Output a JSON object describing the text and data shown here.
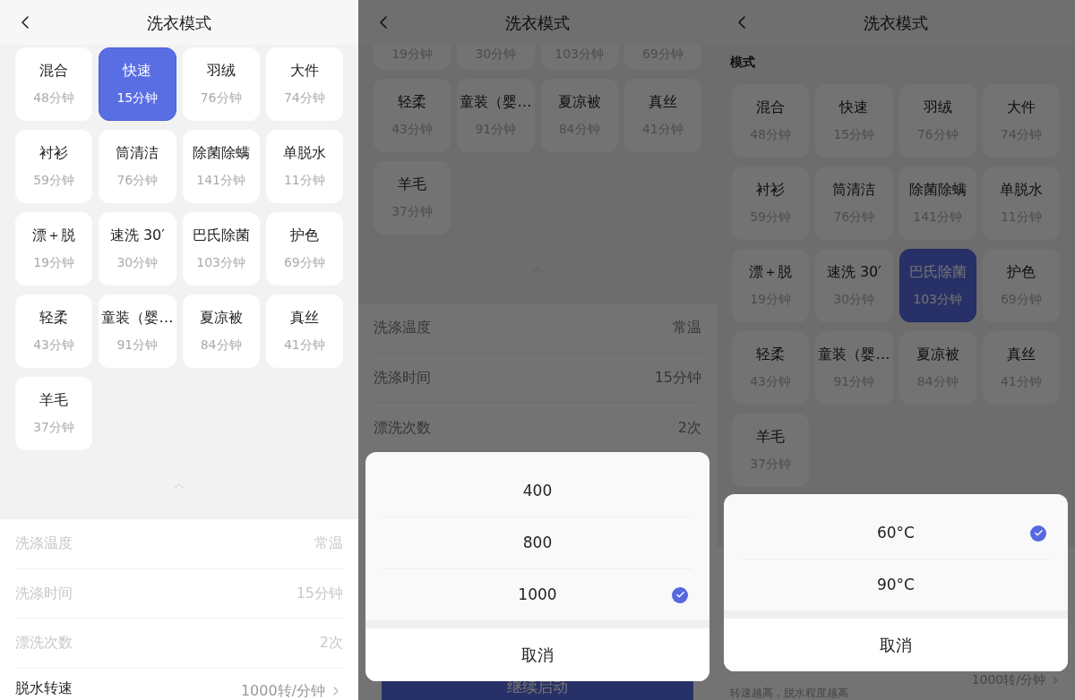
{
  "panels": [
    {
      "title": "洗衣模式",
      "tiles": [
        {
          "name": "混合",
          "time": "48分钟",
          "selected": false
        },
        {
          "name": "快速",
          "time": "15分钟",
          "selected": true
        },
        {
          "name": "羽绒",
          "time": "76分钟",
          "selected": false
        },
        {
          "name": "大件",
          "time": "74分钟",
          "selected": false
        },
        {
          "name": "衬衫",
          "time": "59分钟",
          "selected": false
        },
        {
          "name": "筒清洁",
          "time": "76分钟",
          "selected": false
        },
        {
          "name": "除菌除螨",
          "time": "141分钟",
          "selected": false
        },
        {
          "name": "单脱水",
          "time": "11分钟",
          "selected": false
        },
        {
          "name": "漂＋脱",
          "time": "19分钟",
          "selected": false
        },
        {
          "name": "速洗 30′",
          "time": "30分钟",
          "selected": false
        },
        {
          "name": "巴氏除菌",
          "time": "103分钟",
          "selected": false
        },
        {
          "name": "护色",
          "time": "69分钟",
          "selected": false
        },
        {
          "name": "轻柔",
          "time": "43分钟",
          "selected": false
        },
        {
          "name": "童装（婴…",
          "time": "91分钟",
          "selected": false
        },
        {
          "name": "夏凉被",
          "time": "84分钟",
          "selected": false
        },
        {
          "name": "真丝",
          "time": "41分钟",
          "selected": false
        },
        {
          "name": "羊毛",
          "time": "37分钟",
          "selected": false
        }
      ],
      "settings": [
        {
          "label": "洗涤温度",
          "value": "常温",
          "disabled": true
        },
        {
          "label": "洗涤时间",
          "value": "15分钟",
          "disabled": true
        },
        {
          "label": "漂洗次数",
          "value": "2次",
          "disabled": true
        },
        {
          "label": "脱水转速",
          "value": "1000转/分钟",
          "disabled": false
        }
      ]
    },
    {
      "title": "洗衣模式",
      "cut_row": [
        {
          "time": "19分钟"
        },
        {
          "time": "30分钟"
        },
        {
          "time": "103分钟"
        },
        {
          "time": "69分钟"
        }
      ],
      "tiles": [
        {
          "name": "轻柔",
          "time": "43分钟",
          "selected": false
        },
        {
          "name": "童装（婴…",
          "time": "91分钟",
          "selected": false
        },
        {
          "name": "夏凉被",
          "time": "84分钟",
          "selected": false
        },
        {
          "name": "真丝",
          "time": "41分钟",
          "selected": false
        },
        {
          "name": "羊毛",
          "time": "37分钟",
          "selected": false
        }
      ],
      "settings": [
        {
          "label": "洗涤温度",
          "value": "常温",
          "disabled": true
        },
        {
          "label": "洗涤时间",
          "value": "15分钟",
          "disabled": true
        },
        {
          "label": "漂洗次数",
          "value": "2次",
          "disabled": true
        }
      ],
      "start_button": "继续启动",
      "sheet": {
        "options": [
          {
            "label": "400",
            "selected": false
          },
          {
            "label": "800",
            "selected": false
          },
          {
            "label": "1000",
            "selected": true
          }
        ],
        "cancel": "取消"
      }
    },
    {
      "title": "洗衣模式",
      "section_label": "模式",
      "tiles": [
        {
          "name": "混合",
          "time": "48分钟",
          "selected": false
        },
        {
          "name": "快速",
          "time": "15分钟",
          "selected": false
        },
        {
          "name": "羽绒",
          "time": "76分钟",
          "selected": false
        },
        {
          "name": "大件",
          "time": "74分钟",
          "selected": false
        },
        {
          "name": "衬衫",
          "time": "59分钟",
          "selected": false
        },
        {
          "name": "筒清洁",
          "time": "76分钟",
          "selected": false
        },
        {
          "name": "除菌除螨",
          "time": "141分钟",
          "selected": false
        },
        {
          "name": "单脱水",
          "time": "11分钟",
          "selected": false
        },
        {
          "name": "漂＋脱",
          "time": "19分钟",
          "selected": false
        },
        {
          "name": "速洗 30′",
          "time": "30分钟",
          "selected": false
        },
        {
          "name": "巴氏除菌",
          "time": "103分钟",
          "selected": true
        },
        {
          "name": "护色",
          "time": "69分钟",
          "selected": false
        },
        {
          "name": "轻柔",
          "time": "43分钟",
          "selected": false
        },
        {
          "name": "童装（婴…",
          "time": "91分钟",
          "selected": false
        },
        {
          "name": "夏凉被",
          "time": "84分钟",
          "selected": false
        },
        {
          "name": "真丝",
          "time": "41分钟",
          "selected": false
        },
        {
          "name": "羊毛",
          "time": "37分钟",
          "selected": false
        }
      ],
      "spin": {
        "value": "1000转/分钟",
        "hint": "转速越高，脱水程度越高"
      },
      "sheet": {
        "options": [
          {
            "label": "60°C",
            "selected": true
          },
          {
            "label": "90°C",
            "selected": false
          }
        ],
        "cancel": "取消"
      }
    }
  ]
}
